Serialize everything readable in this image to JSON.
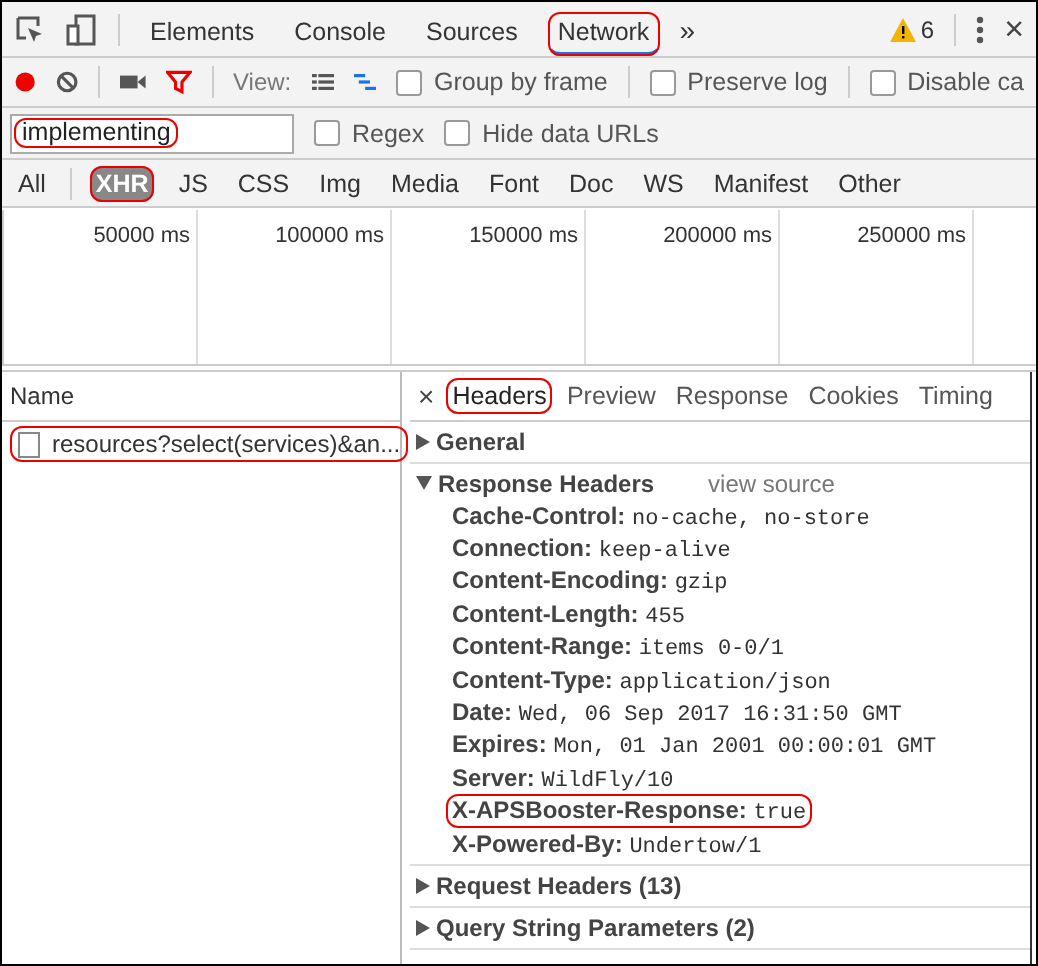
{
  "top_tabs": [
    {
      "label": "Elements",
      "selected": false,
      "highlighted": false
    },
    {
      "label": "Console",
      "selected": false,
      "highlighted": false
    },
    {
      "label": "Sources",
      "selected": false,
      "highlighted": false
    },
    {
      "label": "Network",
      "selected": true,
      "highlighted": true
    }
  ],
  "more": "»",
  "warning_count": "6",
  "close": "×",
  "toolbar": {
    "recording": true,
    "view_label": "View:",
    "options": [
      {
        "label": "Group by frame",
        "checked": false
      },
      {
        "label": "Preserve log",
        "checked": false
      },
      {
        "label": "Disable ca",
        "checked": false
      }
    ]
  },
  "filter": {
    "value": "implementing",
    "highlighted": true,
    "options": [
      {
        "label": "Regex",
        "checked": false
      },
      {
        "label": "Hide data URLs",
        "checked": false
      }
    ]
  },
  "types": [
    {
      "label": "All",
      "selected": false,
      "highlighted": false
    },
    {
      "label": "XHR",
      "selected": true,
      "highlighted": true
    },
    {
      "label": "JS",
      "selected": false,
      "highlighted": false
    },
    {
      "label": "CSS",
      "selected": false,
      "highlighted": false
    },
    {
      "label": "Img",
      "selected": false,
      "highlighted": false
    },
    {
      "label": "Media",
      "selected": false,
      "highlighted": false
    },
    {
      "label": "Font",
      "selected": false,
      "highlighted": false
    },
    {
      "label": "Doc",
      "selected": false,
      "highlighted": false
    },
    {
      "label": "WS",
      "selected": false,
      "highlighted": false
    },
    {
      "label": "Manifest",
      "selected": false,
      "highlighted": false
    },
    {
      "label": "Other",
      "selected": false,
      "highlighted": false
    }
  ],
  "timeline": {
    "ticks": [
      "50000 ms",
      "100000 ms",
      "150000 ms",
      "200000 ms",
      "250000 ms"
    ]
  },
  "requests": {
    "column": "Name",
    "rows": [
      {
        "name": "resources?select(services)&an...",
        "highlighted": true
      }
    ]
  },
  "detail": {
    "close": "×",
    "tabs": [
      {
        "label": "Headers",
        "selected": true,
        "highlighted": true
      },
      {
        "label": "Preview",
        "selected": false,
        "highlighted": false
      },
      {
        "label": "Response",
        "selected": false,
        "highlighted": false
      },
      {
        "label": "Cookies",
        "selected": false,
        "highlighted": false
      },
      {
        "label": "Timing",
        "selected": false,
        "highlighted": false
      }
    ],
    "sections": [
      {
        "title": "General",
        "expanded": false
      },
      {
        "title": "Response Headers",
        "expanded": true,
        "action": "view source",
        "headers": [
          {
            "name": "Cache-Control:",
            "value": "no-cache, no-store",
            "highlighted": false
          },
          {
            "name": "Connection:",
            "value": "keep-alive",
            "highlighted": false
          },
          {
            "name": "Content-Encoding:",
            "value": "gzip",
            "highlighted": false
          },
          {
            "name": "Content-Length:",
            "value": "455",
            "highlighted": false
          },
          {
            "name": "Content-Range:",
            "value": "items 0-0/1",
            "highlighted": false
          },
          {
            "name": "Content-Type:",
            "value": "application/json",
            "highlighted": false
          },
          {
            "name": "Date:",
            "value": "Wed, 06 Sep 2017 16:31:50 GMT",
            "highlighted": false
          },
          {
            "name": "Expires:",
            "value": "Mon, 01 Jan 2001 00:00:01 GMT",
            "highlighted": false
          },
          {
            "name": "Server:",
            "value": "WildFly/10",
            "highlighted": false
          },
          {
            "name": "X-APSBooster-Response:",
            "value": "true",
            "highlighted": true
          },
          {
            "name": "X-Powered-By:",
            "value": "Undertow/1",
            "highlighted": false
          }
        ]
      },
      {
        "title": "Request Headers (13)",
        "expanded": false
      },
      {
        "title": "Query String Parameters (2)",
        "expanded": false
      }
    ]
  }
}
